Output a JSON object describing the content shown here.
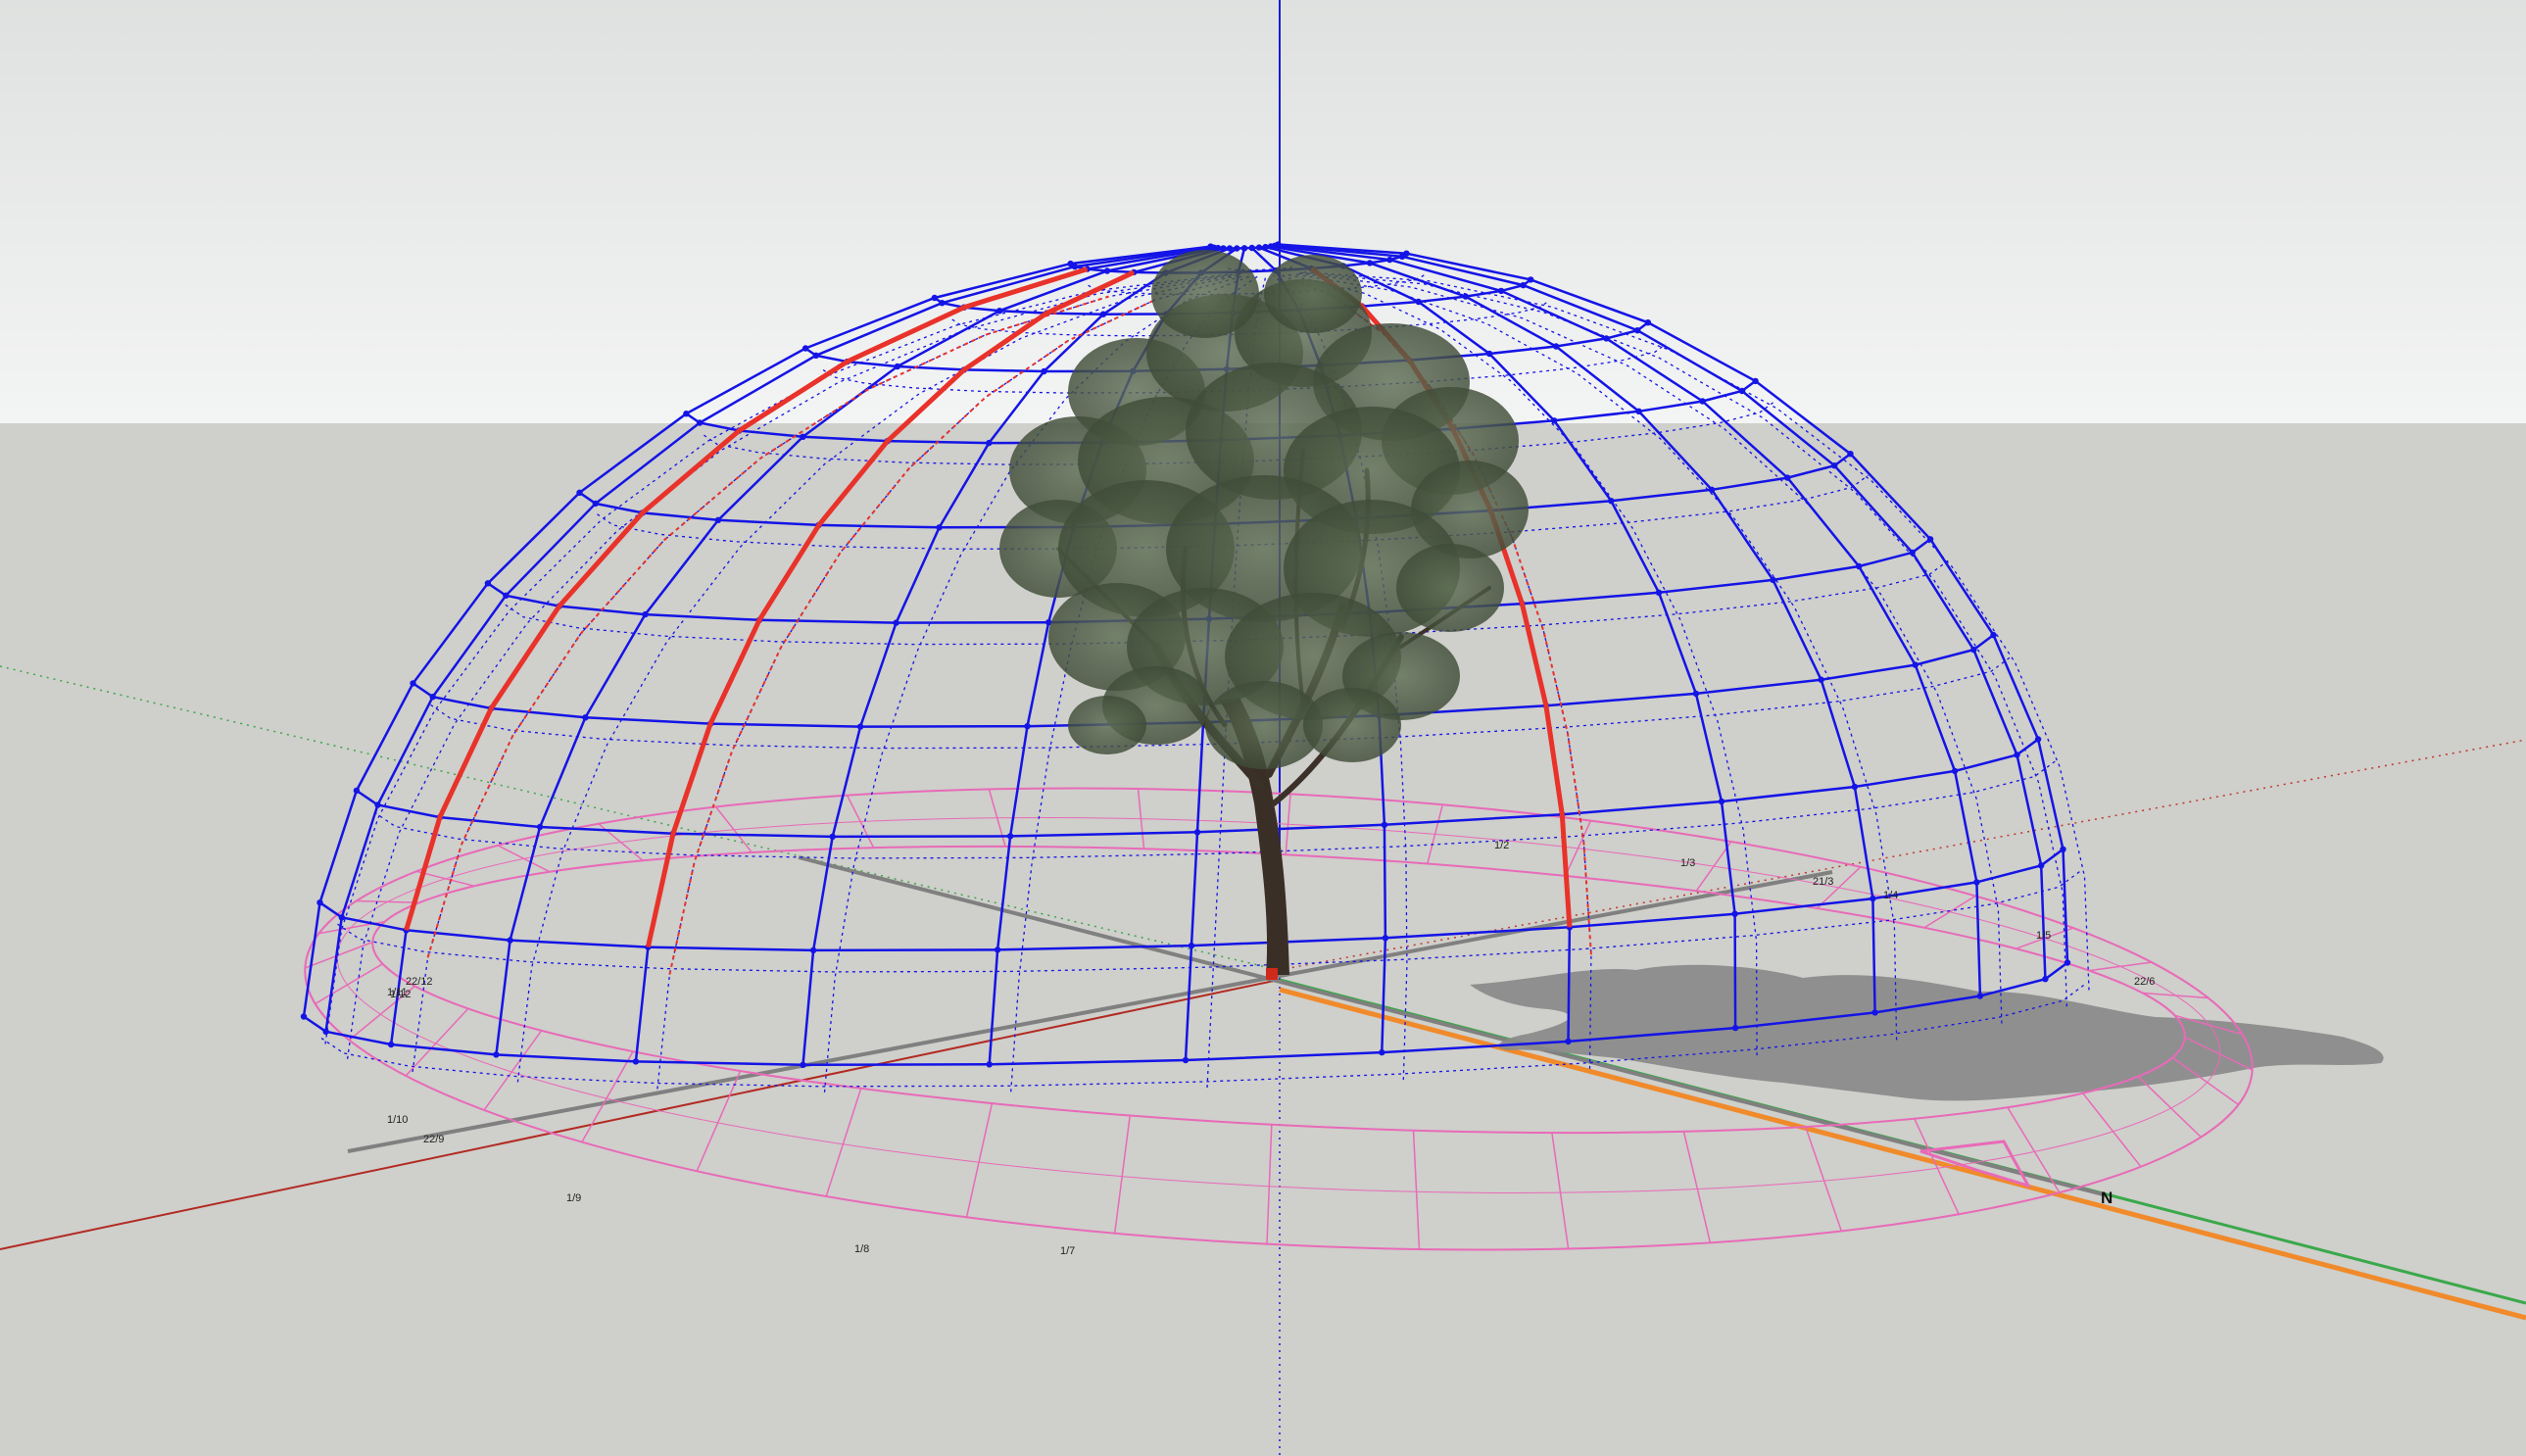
{
  "scene": {
    "colors": {
      "sky_top": "#dcdedd",
      "sky_bottom": "#f2f3f3",
      "ground": "#cfcfcb",
      "sunpath": "#1414e6",
      "highlight": "#e8322a",
      "analemma_ring": "#e86ab8",
      "axis_red": "#c0392b",
      "axis_green": "#3aa84a",
      "axis_blue": "#1a1ad6",
      "north_axis": "#f08a2a",
      "compass_line": "#808080",
      "shadow": "#8a8a8a"
    },
    "icons": {
      "tree": "deciduous-tree-model",
      "north_marker": "north-arrow-triangle"
    },
    "north_label": "N",
    "ring_labels": [
      "1/2",
      "1/3",
      "21/3",
      "1/4",
      "1/5",
      "22/6",
      "1/7",
      "1/8",
      "1/9",
      "22/9",
      "1/10",
      "1/11",
      "1/12",
      "22/12"
    ]
  }
}
